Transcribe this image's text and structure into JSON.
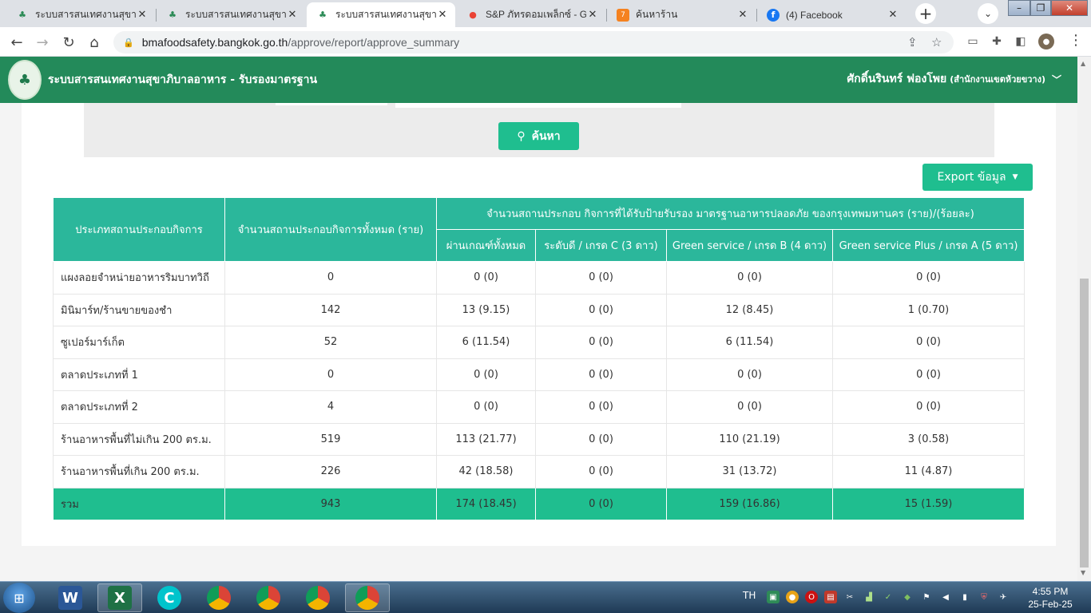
{
  "browser": {
    "tabs": [
      {
        "title": "ระบบสารสนเทศงานสุขาภิบา",
        "icon": "bma-logo-icon",
        "active": false
      },
      {
        "title": "ระบบสารสนเทศงานสุขาภิบา",
        "icon": "bma-logo-icon",
        "active": false
      },
      {
        "title": "ระบบสารสนเทศงานสุขาภิบา",
        "icon": "bma-logo-icon",
        "active": true
      },
      {
        "title": "S&P ภัทรดอมเพล็กซ์ - Go",
        "icon": "google-maps-icon",
        "active": false
      },
      {
        "title": "ค้นหาร้าน",
        "icon": "seven-eleven-icon",
        "active": false
      },
      {
        "title": "(4) Facebook",
        "icon": "facebook-icon",
        "active": false
      }
    ],
    "url_host": "bmafoodsafety.bangkok.go.th",
    "url_path": "/approve/report/approve_summary"
  },
  "app": {
    "title": "ระบบสารสนเทศงานสุขาภิบาลอาหาร - รับรองมาตรฐาน",
    "user_name": "ศักดิ์นรินทร์ ฟองโพย",
    "user_unit": "(สำนักงานเขตห้วยขวาง)"
  },
  "search": {
    "button_label": "ค้นหา"
  },
  "export": {
    "button_label": "Export ข้อมูล"
  },
  "table": {
    "col_type": "ประเภทสถานประกอบกิจการ",
    "col_total": "จำนวนสถานประกอบกิจการทั้งหมด (ราย)",
    "col_group": "จำนวนสถานประกอบ กิจการที่ได้รับป้ายรับรอง มาตรฐานอาหารปลอดภัย ของกรุงเทพมหานคร (ราย)/(ร้อยละ)",
    "sub_headers": [
      "ผ่านเกณฑ์ทั้งหมด",
      "ระดับดี / เกรด C (3 ดาว)",
      "Green service / เกรด B (4 ดาว)",
      "Green service Plus / เกรด A (5 ดาว)"
    ],
    "rows": [
      {
        "name": "แผงลอยจำหน่ายอาหารริมบาทวิถี",
        "total": "0",
        "pass": "0 (0)",
        "c": "0 (0)",
        "b": "0 (0)",
        "a": "0 (0)"
      },
      {
        "name": "มินิมาร์ท/ร้านขายของชำ",
        "total": "142",
        "pass": "13 (9.15)",
        "c": "0 (0)",
        "b": "12 (8.45)",
        "a": "1 (0.70)"
      },
      {
        "name": "ซูเปอร์มาร์เก็ต",
        "total": "52",
        "pass": "6 (11.54)",
        "c": "0 (0)",
        "b": "6 (11.54)",
        "a": "0 (0)"
      },
      {
        "name": "ตลาดประเภทที่ 1",
        "total": "0",
        "pass": "0 (0)",
        "c": "0 (0)",
        "b": "0 (0)",
        "a": "0 (0)"
      },
      {
        "name": "ตลาดประเภทที่ 2",
        "total": "4",
        "pass": "0 (0)",
        "c": "0 (0)",
        "b": "0 (0)",
        "a": "0 (0)"
      },
      {
        "name": "ร้านอาหารพื้นที่ไม่เกิน 200 ตร.ม.",
        "total": "519",
        "pass": "113 (21.77)",
        "c": "0 (0)",
        "b": "110 (21.19)",
        "a": "3 (0.58)"
      },
      {
        "name": "ร้านอาหารพื้นที่เกิน 200 ตร.ม.",
        "total": "226",
        "pass": "42 (18.58)",
        "c": "0 (0)",
        "b": "31 (13.72)",
        "a": "11 (4.87)"
      }
    ],
    "total_row": {
      "name": "รวม",
      "total": "943",
      "pass": "174 (18.45)",
      "c": "0 (0)",
      "b": "159 (16.86)",
      "a": "15 (1.59)"
    }
  },
  "taskbar": {
    "apps": [
      {
        "name": "word-icon",
        "label": "W"
      },
      {
        "name": "excel-icon",
        "label": "X"
      },
      {
        "name": "canva-icon",
        "label": "C"
      },
      {
        "name": "chrome-icon",
        "label": ""
      },
      {
        "name": "chrome-icon",
        "label": ""
      },
      {
        "name": "chrome-icon",
        "label": ""
      },
      {
        "name": "chrome-icon",
        "label": ""
      }
    ],
    "lang": "TH",
    "time": "4:55 PM",
    "date": "25-Feb-25"
  },
  "colors": {
    "app_header": "#238a5a",
    "table_header": "#2bb79b",
    "accent_button": "#1fbe8f"
  }
}
